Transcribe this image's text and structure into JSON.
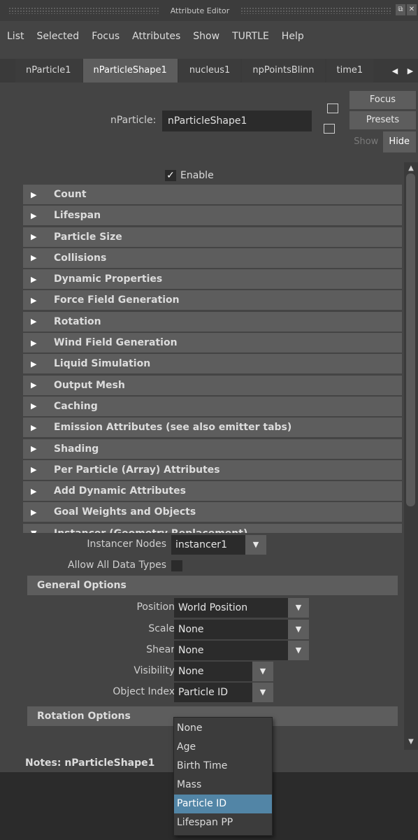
{
  "window": {
    "title": "Attribute Editor"
  },
  "menu": [
    "List",
    "Selected",
    "Focus",
    "Attributes",
    "Show",
    "TURTLE",
    "Help"
  ],
  "tabs": [
    {
      "label": "nParticle1",
      "active": false
    },
    {
      "label": "nParticleShape1",
      "active": true
    },
    {
      "label": "nucleus1",
      "active": false
    },
    {
      "label": "npPointsBlinn",
      "active": false
    },
    {
      "label": "time1",
      "active": false
    }
  ],
  "node": {
    "label": "nParticle:",
    "value": "nParticleShape1"
  },
  "buttons": {
    "focus": "Focus",
    "presets": "Presets",
    "show": "Show",
    "hide": "Hide"
  },
  "enable": {
    "label": "Enable",
    "checked": true
  },
  "sections": [
    "Count",
    "Lifespan",
    "Particle Size",
    "Collisions",
    "Dynamic Properties",
    "Force Field Generation",
    "Rotation",
    "Wind Field Generation",
    "Liquid Simulation",
    "Output Mesh",
    "Caching",
    "Emission Attributes (see also emitter tabs)",
    "Shading",
    "Per Particle (Array) Attributes",
    "Add Dynamic Attributes",
    "Goal Weights and Objects"
  ],
  "instancer": {
    "title": "Instancer (Geometry Replacement)",
    "nodes_label": "Instancer Nodes",
    "nodes_value": "instancer1",
    "allow_label": "Allow All Data Types",
    "general_title": "General Options",
    "position_label": "Position",
    "position_value": "World Position",
    "scale_label": "Scale",
    "scale_value": "None",
    "shear_label": "Shear",
    "shear_value": "None",
    "visibility_label": "Visibility",
    "visibility_value": "None",
    "index_label": "Object Index",
    "index_value": "Particle ID",
    "rotation_title": "Rotation Options"
  },
  "notes": {
    "label": "Notes:  nParticleShape1"
  },
  "dropdown_options": [
    "None",
    "Age",
    "Birth Time",
    "Mass",
    "Particle ID",
    "Lifespan PP"
  ],
  "dropdown_selected": "Particle ID"
}
